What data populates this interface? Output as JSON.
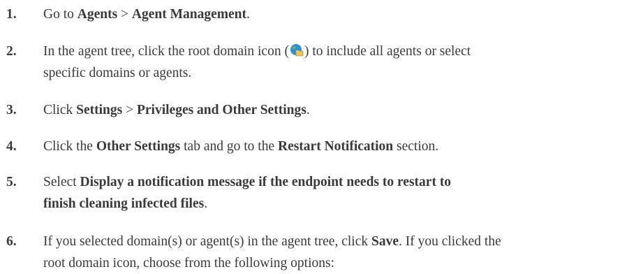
{
  "steps": [
    {
      "number": "1.",
      "line1": {
        "t1": "Go to ",
        "b1": "Agents",
        "t2": " > ",
        "b2": "Agent Management",
        "t3": "."
      }
    },
    {
      "number": "2.",
      "line1": {
        "t1": "In the agent tree, click the root domain icon (",
        "t2": ") to include all agents or select"
      },
      "line2": "specific domains or agents.",
      "icon": "globe-folder-icon"
    },
    {
      "number": "3.",
      "line1": {
        "t1": "Click ",
        "b1": "Settings",
        "t2": " > ",
        "b2": "Privileges and Other Settings",
        "t3": "."
      }
    },
    {
      "number": "4.",
      "line1": {
        "t1": "Click the ",
        "b1": "Other Settings",
        "t2": " tab and go to the ",
        "b2": "Restart Notification",
        "t3": " section."
      }
    },
    {
      "number": "5.",
      "line1": {
        "t1": "Select ",
        "b1": "Display a notification message if the endpoint needs to restart to"
      },
      "line2": {
        "b1": "finish cleaning infected files",
        "t1": "."
      }
    },
    {
      "number": "6.",
      "line1": {
        "t1": "If you selected domain(s) or agent(s) in the agent tree, click ",
        "b1": "Save",
        "t2": ". If you clicked the"
      },
      "line2": "root domain icon, choose from the following options:"
    }
  ],
  "colors": {
    "text": "#3a3a3a",
    "icon_globe": "#2e8fd6",
    "icon_land": "#5cb85c",
    "icon_folder": "#e8c45a"
  }
}
